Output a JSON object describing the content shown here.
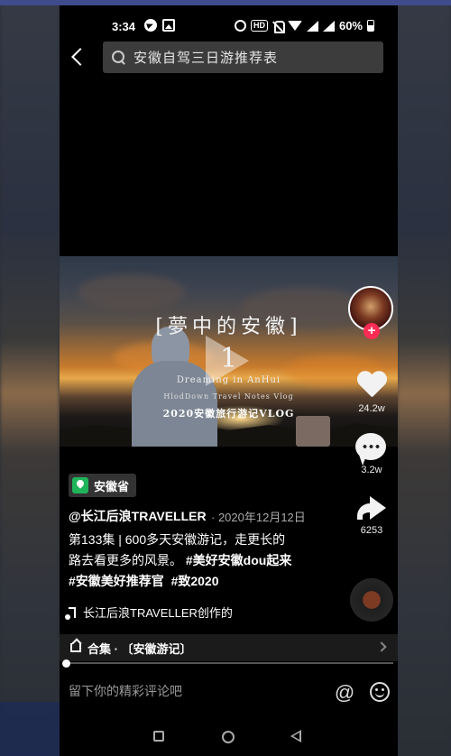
{
  "status_bar": {
    "time": "3:34",
    "network_badge": "HD",
    "battery": "60%"
  },
  "search": {
    "query": "安徽自驾三日游推荐表"
  },
  "video": {
    "title_line": "[夢中的安徽]",
    "episode_number": "1",
    "subtitle_en": "Dreaming in AnHui",
    "credit_en": "HlodDown Travel Notes Vlog",
    "caption_cn": "2020安徽旅行游记VLOG"
  },
  "actions": {
    "likes": "24.2w",
    "comments": "3.2w",
    "shares": "6253",
    "follow_plus": "+"
  },
  "post": {
    "location": "安徽省",
    "author": "@长江后浪TRAVELLER",
    "date": "· 2020年12月12日",
    "desc_line1": "第133集 | 600多天安徽游记，走更长的",
    "desc_line2_plain": "路去看更多的风景。",
    "hashtag1": "#美好安徽dou起来",
    "hashtag2": "#安徽美好推荐官",
    "hashtag3": "#致2020",
    "music": "长江后浪TRAVELLER创作的"
  },
  "collection": {
    "label": "合集 · 〔安徽游记〕"
  },
  "comment_bar": {
    "placeholder": "留下你的精彩评论吧",
    "at_symbol": "@"
  },
  "colors": {
    "accent": "#fe2c55",
    "location_green": "#1fb35a"
  }
}
